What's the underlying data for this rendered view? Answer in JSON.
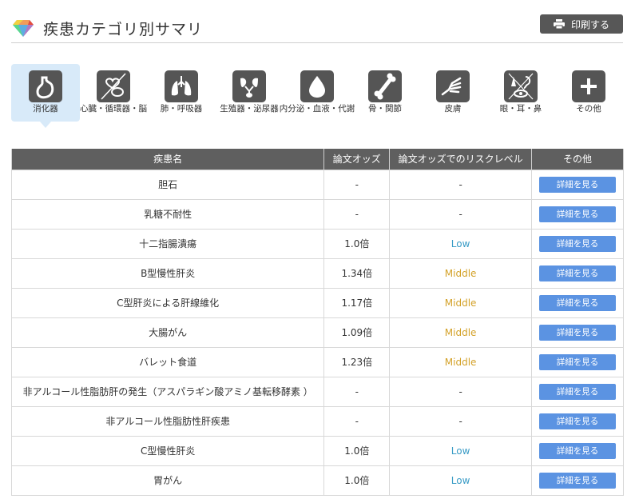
{
  "header": {
    "title": "疾患カテゴリ別サマリ",
    "print_label": "印刷する"
  },
  "categories": [
    {
      "label": "消化器",
      "icon": "stomach-icon",
      "active": true
    },
    {
      "label": "心臓・循環器・脳",
      "icon": "heart-brain-icon"
    },
    {
      "label": "肺・呼吸器",
      "icon": "lungs-icon"
    },
    {
      "label": "生殖器・泌尿器",
      "icon": "kidney-icon"
    },
    {
      "label": "内分泌・血液・代謝",
      "icon": "blood-drop-icon"
    },
    {
      "label": "骨・関節",
      "icon": "bone-icon"
    },
    {
      "label": "皮膚",
      "icon": "skin-hand-icon"
    },
    {
      "label": "眼・耳・鼻",
      "icon": "eye-ear-nose-icon"
    },
    {
      "label": "その他",
      "icon": "plus-icon"
    }
  ],
  "table": {
    "headers": [
      "疾患名",
      "論文オッズ",
      "論文オッズでのリスクレベル",
      "その他"
    ],
    "detail_label": "詳細を見る",
    "rows": [
      {
        "name": "胆石",
        "odds": "-",
        "level": "-"
      },
      {
        "name": "乳糖不耐性",
        "odds": "-",
        "level": "-"
      },
      {
        "name": "十二指腸潰瘍",
        "odds": "1.0倍",
        "level": "Low"
      },
      {
        "name": "B型慢性肝炎",
        "odds": "1.34倍",
        "level": "Middle"
      },
      {
        "name": "C型肝炎による肝線維化",
        "odds": "1.17倍",
        "level": "Middle"
      },
      {
        "name": "大腸がん",
        "odds": "1.09倍",
        "level": "Middle"
      },
      {
        "name": "バレット食道",
        "odds": "1.23倍",
        "level": "Middle"
      },
      {
        "name": "非アルコール性脂肪肝の発生（アスパラギン酸アミノ基転移酵素 ）",
        "odds": "-",
        "level": "-"
      },
      {
        "name": "非アルコール性脂肪性肝疾患",
        "odds": "-",
        "level": "-"
      },
      {
        "name": "C型慢性肝炎",
        "odds": "1.0倍",
        "level": "Low"
      },
      {
        "name": "胃がん",
        "odds": "1.0倍",
        "level": "Low"
      }
    ]
  },
  "colors": {
    "low": "#3a9cc6",
    "middle": "#d3a128",
    "button": "#5b93e2",
    "header": "#5f5f5f",
    "active_tab": "#d8eaf9"
  }
}
